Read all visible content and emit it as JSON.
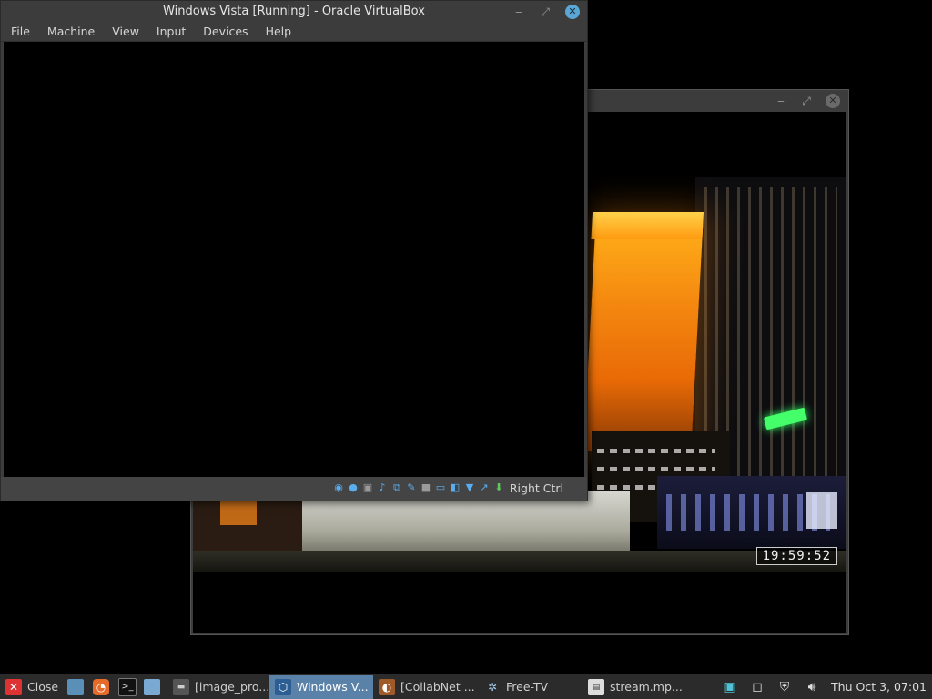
{
  "video_window": {
    "timestamp": "19:59:52",
    "minimize_glyph": "‒",
    "maximize_glyph": "⤢",
    "close_glyph": "✕"
  },
  "vbox_window": {
    "title": "Windows Vista [Running] - Oracle VirtualBox",
    "minimize_glyph": "‒",
    "maximize_glyph": "⤢",
    "close_glyph": "✕",
    "menu": [
      "File",
      "Machine",
      "View",
      "Input",
      "Devices",
      "Help"
    ],
    "status_icons": [
      "hard-disk-icon",
      "optical-disk-icon",
      "floppy-icon",
      "audio-icon",
      "network-icon",
      "usb-icon",
      "shared-folder-icon",
      "display-icon",
      "video-capture-icon",
      "virtualization-icon",
      "mouse-integration-icon",
      "keyboard-icon"
    ],
    "host_key": "Right Ctrl"
  },
  "taskbar": {
    "close_label": "Close",
    "windows": [
      {
        "label": "[image_pro...",
        "icon": "terminal-icon"
      },
      {
        "label": "Windows V...",
        "icon": "virtualbox-icon",
        "active": true
      },
      {
        "label": "[CollabNet ...",
        "icon": "app-icon"
      },
      {
        "label": "Free-TV",
        "icon": "tv-icon"
      },
      {
        "label": "stream.mp...",
        "icon": "video-file-icon"
      }
    ],
    "clock": "Thu Oct  3, 07:01"
  },
  "colors": {
    "window_bg": "#3c3c3c",
    "taskbar_bg": "#2b2b2b",
    "active_task": "#5a82a8",
    "accent_close": "#5aa6d6"
  }
}
